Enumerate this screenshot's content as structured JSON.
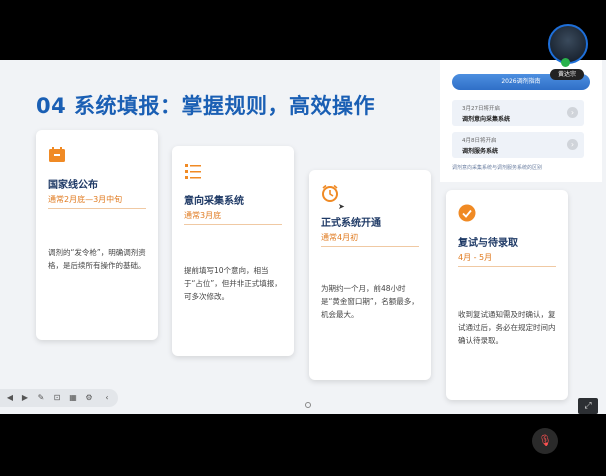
{
  "slide": {
    "title": "04 系统填报：掌握规则，高效操作",
    "cards": [
      {
        "heading": "国家线公布",
        "subtitle": "通常2月底—3月中旬",
        "body": "调剂的“发令枪”，明确调剂资格，是后续所有操作的基础。",
        "icon": "calendar-icon"
      },
      {
        "heading": "意向采集系统",
        "subtitle": "通常3月底",
        "body": "提前填写10个意向，相当于“占位”，但并非正式填报，可多次修改。",
        "icon": "list-icon"
      },
      {
        "heading": "正式系统开通",
        "subtitle": "通常4月初",
        "body": "为期约一个月，前48小时是“黄金窗口期”，名额最多，机会最大。",
        "icon": "alarm-clock-icon"
      },
      {
        "heading": "复试与待录取",
        "subtitle": "4月 - 5月",
        "body": "收到复试通知需及时确认，复试通过后，务必在规定时间内确认待录取。",
        "icon": "check-circle-icon"
      }
    ]
  },
  "pip": {
    "header": "2026调剂指南",
    "rows": [
      {
        "date": "3月27日将开启",
        "label": "调剂意向采集系统"
      },
      {
        "date": "4月8日将开启",
        "label": "调剂服务系统"
      }
    ],
    "footer": "调剂意向采集系统与调剂服务系统的区别"
  },
  "participant": {
    "name": "黄达宗"
  },
  "colors": {
    "accent": "#1a5fb4",
    "orange": "#e07a1f",
    "heading": "#1f3a66"
  }
}
